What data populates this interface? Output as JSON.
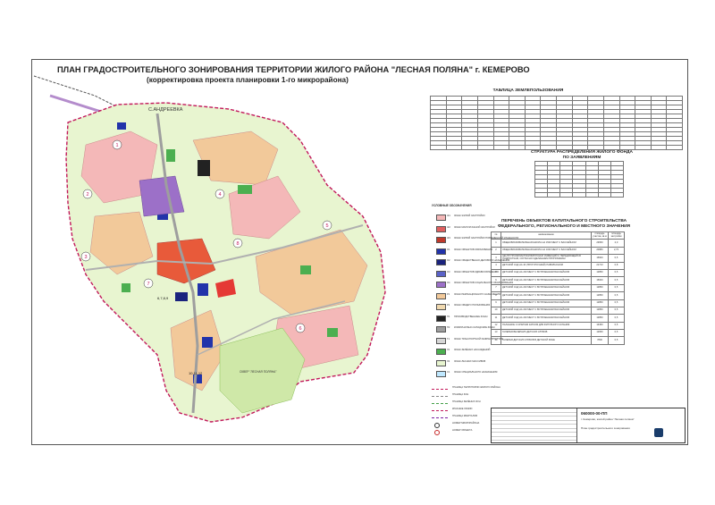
{
  "title": {
    "line1": "ПЛАН ГРАДОСТРОИТЕЛЬНОГО ЗОНИРОВАНИЯ ТЕРРИТОРИИ ЖИЛОГО РАЙОНА \"ЛЕСНАЯ ПОЛЯНА\" г. КЕМЕРОВО",
    "line2": "(корректировка проекта планировки 1-го микрорайона)"
  },
  "tables": {
    "land_use_title": "ТАБЛИЦА ЗЕМЛЕПОЛЬЗОВАНИЯ",
    "housing_title": "СТРУКТУРА РАСПРЕДЕЛЕНИЯ ЖИЛОГО ФОНДА ПО ЗАЯВЛЕНИЯМ",
    "objects_title": "ПЕРЕЧЕНЬ ОБЪЕКТОВ КАПИТАЛЬНОГО СТРОИТЕЛЬСТВА ФЕДЕРАЛЬНОГО, РЕГИОНАЛЬНОГО И МЕСТНОГО ЗНАЧЕНИЯ",
    "objects_header": [
      "№",
      "наименование",
      "площадь участка, кв.м",
      "площадь застройки"
    ],
    "objects": [
      {
        "no": "1",
        "name": "ОБЩЕОБРАЗОВАТЕЛЬНАЯ ШКОЛА НА 1500 МЕСТ С БАССЕЙНОМ",
        "a": "23650",
        "b": "2,0"
      },
      {
        "no": "2",
        "name": "ОБЩЕОБРАЗОВАТЕЛЬНАЯ ШКОЛА НА 1000 МЕСТ С БАССЕЙНОМ",
        "a": "20880",
        "b": "2,73"
      },
      {
        "no": "3",
        "name": "ЦЕНТР ПРОФИЛАКТИКИ ВИРУСНЫХ ИНФЕКЦИЙ С ПЕРЕДАЮЩЕЙСЯ ПОДРОСТКАМ, СОГЛАСНО СДЕЛАННЫМ ПРОГРАММАМ",
        "a": "15600",
        "b": "0,5"
      },
      {
        "no": "4",
        "name": "ДЕТСКИЙ САД НА 40 (ПРОГУЛОЧНЫЙ) ПАВИЛЬОНОМ",
        "a": "21713",
        "b": "0,8"
      },
      {
        "no": "5",
        "name": "ДЕТСКИЙ САД НА 220 МЕСТ С ВСТРОЕННЫМ БАССЕЙНОМ",
        "a": "12850",
        "b": "0,5"
      },
      {
        "no": "6",
        "name": "ДЕТСКИЙ САД НА 220 МЕСТ С ВСТРОЕННЫМ БАССЕЙНОМ",
        "a": "15000",
        "b": "0,5"
      },
      {
        "no": "7",
        "name": "ДЕТСКИЙ САД НА 220 МЕСТ С ВСТРОЕННЫМ БАССЕЙНОМ",
        "a": "12850",
        "b": "0,5"
      },
      {
        "no": "8",
        "name": "ДЕТСКИЙ САД НА 220 МЕСТ С ВСТРОЕННЫМ БАССЕЙНОМ",
        "a": "12850",
        "b": "0,5"
      },
      {
        "no": "9",
        "name": "ДЕТСКИЙ САД НА 220 МЕСТ С ВСТРОЕННЫМ БАССЕЙНОМ",
        "a": "12850",
        "b": "0,5"
      },
      {
        "no": "10",
        "name": "ДЕТСКИЙ САД НА 220 МЕСТ С ВСТРОЕННЫМ БАССЕЙНОМ",
        "a": "12850",
        "b": "0,5"
      },
      {
        "no": "11",
        "name": "ДЕТСКИЙ САД НА 220 МЕСТ С ВСТРОЕННЫМ БАССЕЙНОМ",
        "a": "12850",
        "b": "0,5"
      },
      {
        "no": "12",
        "name": "ПАЛАНКИН С КРЫТЫМ КАТКОМ ДЛЯ ФИГУРНОГО КАТАНИЯ",
        "a": "16450",
        "b": "0,5"
      },
      {
        "no": "13",
        "name": "ГАЛЕРЕЯ ВЕЧЕРНИХ ДЕТСКИХ КЛУБОВ",
        "a": "12650",
        "b": "0,5"
      },
      {
        "no": "14",
        "name": "ГАЛЕРЕЯ ДЕТСКИХ КЛУБОВ В ДЕТСКОЙ ЗОНЕ",
        "a": "7800",
        "b": "0,5"
      }
    ]
  },
  "legend": {
    "title": "УСЛОВНЫЕ ОБОЗНАЧЕНИЯ",
    "zones": [
      {
        "code": "Ж1",
        "color": "#f4b8b8",
        "text": "ЗОНЫ ЖИЛОЙ ЗАСТРОЙКИ"
      },
      {
        "code": "Ж2",
        "color": "#e06060",
        "text": "ЗОНЫ МАЛОЭТАЖНОЙ ЗАСТРОЙКИ"
      },
      {
        "code": "Ж3",
        "color": "#c0392b",
        "text": "ЗОНЫ ЖИЛОЙ ЗАСТРОЙКИ ПОВЫШЕННОЙ ЭТАЖНОСТИ"
      },
      {
        "code": "О1",
        "color": "#2233aa",
        "text": "ЗОНЫ ОБЪЕКТОВ ОБРАЗОВАНИЯ"
      },
      {
        "code": "О2",
        "color": "#1a237e",
        "text": "ЗОНЫ ОБЩЕСТВЕННО-ДЕЛОВОГО НАЗНАЧЕНИЯ"
      },
      {
        "code": "О3",
        "color": "#5a62c8",
        "text": "ЗОНЫ ОБЪЕКТОВ ЗДРАВООХРАНЕНИЯ"
      },
      {
        "code": "О4",
        "color": "#9c70c8",
        "text": "ЗОНЫ ОБЪЕКТОВ СОЦИАЛЬНОГО ОБСЛУЖИВАНИЯ"
      },
      {
        "code": "Р1",
        "color": "#f2c99a",
        "text": "ЗОНЫ РЕКРЕАЦИОННОГО НАЗНАЧЕНИЯ"
      },
      {
        "code": "Р2",
        "color": "#f0d9b0",
        "text": "ЗОНЫ ОБЩЕГО ПОЛЬЗОВАНИЯ"
      },
      {
        "code": "П1",
        "color": "#222222",
        "text": "ПРОИЗВОДСТВЕННЫЕ ЗОНЫ"
      },
      {
        "code": "П2",
        "color": "#9e9e9e",
        "text": "КОММУНАЛЬНО-СКЛАДСКИЕ ЗОНЫ"
      },
      {
        "code": "Т1",
        "color": "#d6d6d6",
        "text": "ЗОНЫ ТРАНСПОРТНОЙ ИНФРАСТРУКТУРЫ"
      },
      {
        "code": "Л1",
        "color": "#4caf50",
        "text": "ЗОНЫ ЗЕЛЁНЫХ НАСАЖДЕНИЙ"
      },
      {
        "code": "Л2",
        "color": "#e8f5d0",
        "text": "ЗОНЫ ЛЕСНЫХ МАССИВОВ"
      },
      {
        "code": "С1",
        "color": "#bfe8ff",
        "text": "ЗОНЫ СПЕЦИАЛЬНОГО НАЗНАЧЕНИЯ"
      }
    ],
    "lines": [
      {
        "style": "dash-magenta",
        "text": "ГРАНИЦА ТЕРРИТОРИИ ЖИЛОГО РАЙОНА"
      },
      {
        "style": "dash-gray",
        "text": "ГРАНИЦА ЗОН"
      },
      {
        "style": "dash-green",
        "text": "ГРАНИЦА ЗЕЛЁНЫХ ЗОН"
      },
      {
        "style": "dash-magenta",
        "text": "КРАСНЫЕ ЛИНИИ"
      },
      {
        "style": "dash-purple",
        "text": "ГРАНИЦА КВАРТАЛОВ"
      },
      {
        "style": "circle",
        "text": "НОМЕР МИКРОРАЙОНА"
      },
      {
        "style": "circle-red",
        "text": "НОМЕР ОБЪЕКТА"
      }
    ]
  },
  "map_labels": {
    "road": "С.АНДРЕЕВКА",
    "park": "СКВЕР \"ЛЕСНАЯ ПОЛЯНА\"",
    "numbers": [
      "1",
      "2",
      "3",
      "4",
      "5",
      "6",
      "7",
      "8"
    ],
    "objects_a": "6,7,8,9",
    "objects_b": "10,11,12"
  },
  "stamp": {
    "code": "060000-00-ПП",
    "sub": "г. Кемерово, жилой район \"Лесная поляна\"",
    "sheet": "План градостроительного зонирования"
  }
}
